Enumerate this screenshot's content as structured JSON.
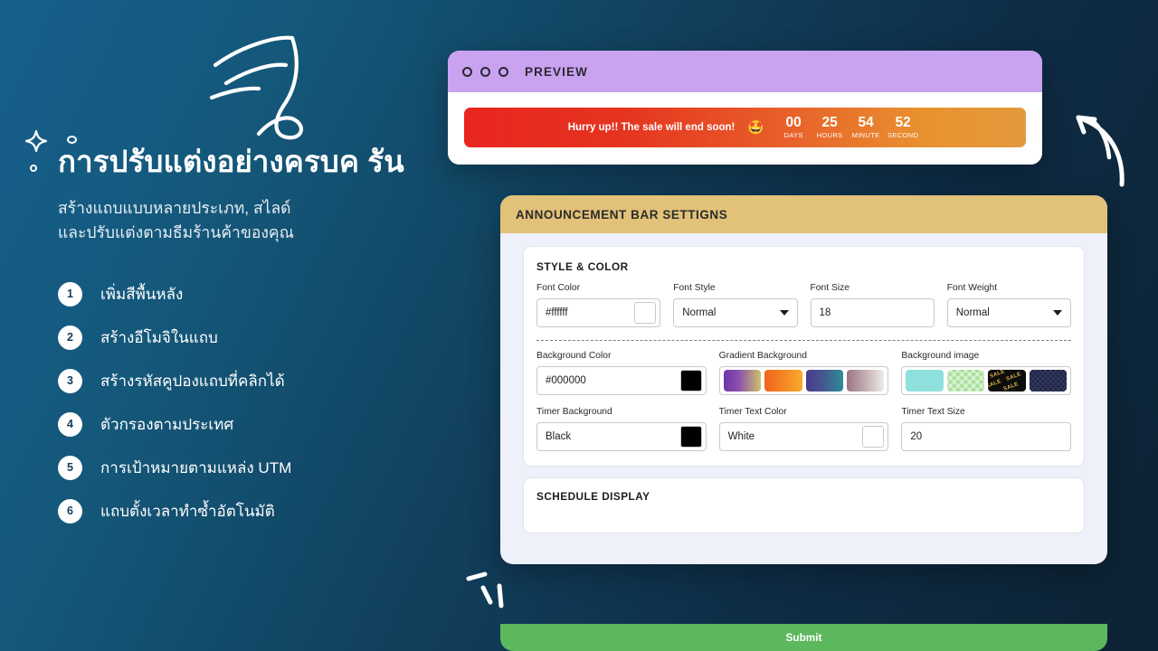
{
  "hero": {
    "headline": "การปรับแต่งอย่างครบค\nรัน",
    "subhead_line1": "สร้างแถบแบบหลายประเภท, สไลด์",
    "subhead_line2": "และปรับแต่งตามธีมร้านค้าของคุณ",
    "features": [
      {
        "num": "1",
        "label": "เพิ่มสีพื้นหลัง"
      },
      {
        "num": "2",
        "label": "สร้างอีโมจิในแถบ"
      },
      {
        "num": "3",
        "label": "สร้างรหัสคูปองแถบที่คลิกได้"
      },
      {
        "num": "4",
        "label": "ตัวกรองตามประเทศ"
      },
      {
        "num": "5",
        "label": "การเป้าหมายตามแหล่ง UTM"
      },
      {
        "num": "6",
        "label": "แถบตั้งเวลาทำซ้ำอัตโนมัติ"
      }
    ]
  },
  "preview": {
    "title": "PREVIEW",
    "titlebar_color": "#c9a3ef",
    "announcement": {
      "message": "Hurry up!! The sale will end soon!",
      "emoji": "🤩",
      "timer": [
        {
          "value": "00",
          "caption": "DAYS"
        },
        {
          "value": "25",
          "caption": "HOURS"
        },
        {
          "value": "54",
          "caption": "MINUTE"
        },
        {
          "value": "52",
          "caption": "SECOND"
        }
      ]
    }
  },
  "settings": {
    "header_title": "ANNOUNCEMENT BAR SETTIGNS",
    "header_color": "#e2c178",
    "style_section": {
      "title": "STYLE & COLOR",
      "row1": [
        {
          "label": "Font Color",
          "value": "#ffffff",
          "type": "color",
          "swatch": "#ffffff"
        },
        {
          "label": "Font Style",
          "value": "Normal",
          "type": "select"
        },
        {
          "label": "Font Size",
          "value": "18",
          "type": "text"
        },
        {
          "label": "Font Weight",
          "value": "Normal",
          "type": "select"
        }
      ],
      "row2": {
        "background_color": {
          "label": "Background Color",
          "value": "#000000",
          "swatch": "#000000"
        },
        "gradient_background": {
          "label": "Gradient Background",
          "options": [
            {
              "name": "purple-khaki",
              "css": "linear-gradient(90deg,#6f35a8 0%,#8a4fae 40%,#cfc06a 100%)"
            },
            {
              "name": "orange-amber",
              "css": "linear-gradient(90deg,#f2621f 0%,#f58a22 55%,#f9ab2e 100%)"
            },
            {
              "name": "indigo-teal",
              "css": "linear-gradient(90deg,#4b3a8f 0%,#46578f 45%,#2f8c9b 100%)"
            },
            {
              "name": "mauve-white",
              "css": "linear-gradient(90deg,#9a7580 0%,#c3aeb2 50%,#efeaea 100%)"
            }
          ]
        },
        "background_image": {
          "label": "Background image",
          "options": [
            {
              "name": "solid-teal",
              "css": "#8ee0dc"
            },
            {
              "name": "green-diamond",
              "css": "#a9e09a"
            },
            {
              "name": "black-sale",
              "css": "#0d0d0d",
              "text": "SALE"
            },
            {
              "name": "navy-texture",
              "css": "#1e2448"
            }
          ]
        }
      },
      "row3": [
        {
          "label": "Timer Background",
          "value": "Black",
          "type": "color",
          "swatch": "#000000"
        },
        {
          "label": "Timer Text Color",
          "value": "White",
          "type": "color",
          "swatch": "#ffffff"
        },
        {
          "label": "Timer Text Size",
          "value": "20",
          "type": "text"
        }
      ]
    },
    "schedule_section": {
      "title": "SCHEDULE DISPLAY"
    },
    "submit_label": "Submit",
    "submit_color": "#5cb85c"
  }
}
